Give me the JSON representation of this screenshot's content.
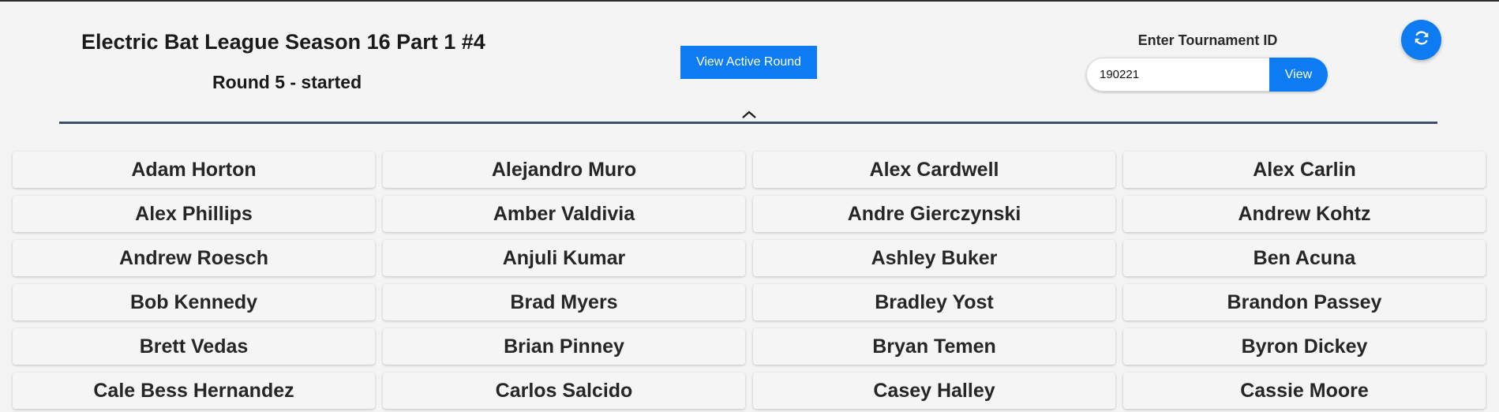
{
  "header": {
    "title": "Electric Bat League Season 16 Part 1 #4",
    "round_status": "Round 5 - started",
    "active_round_label": "View Active Round",
    "tournament_id_label": "Enter Tournament ID",
    "tournament_id_value": "190221",
    "view_label": "View",
    "refresh_icon": "refresh-icon",
    "collapse_icon": "chevron-up-icon"
  },
  "colors": {
    "accent": "#0d7bf2",
    "divider": "#3b4f6a",
    "background": "#f4f4f4"
  },
  "players": [
    "Adam Horton",
    "Alejandro Muro",
    "Alex Cardwell",
    "Alex Carlin",
    "Alex Phillips",
    "Amber Valdivia",
    "Andre Gierczynski",
    "Andrew Kohtz",
    "Andrew Roesch",
    "Anjuli Kumar",
    "Ashley Buker",
    "Ben Acuna",
    "Bob Kennedy",
    "Brad Myers",
    "Bradley Yost",
    "Brandon Passey",
    "Brett Vedas",
    "Brian Pinney",
    "Bryan Temen",
    "Byron Dickey",
    "Cale Bess Hernandez",
    "Carlos Salcido",
    "Casey Halley",
    "Cassie Moore"
  ]
}
